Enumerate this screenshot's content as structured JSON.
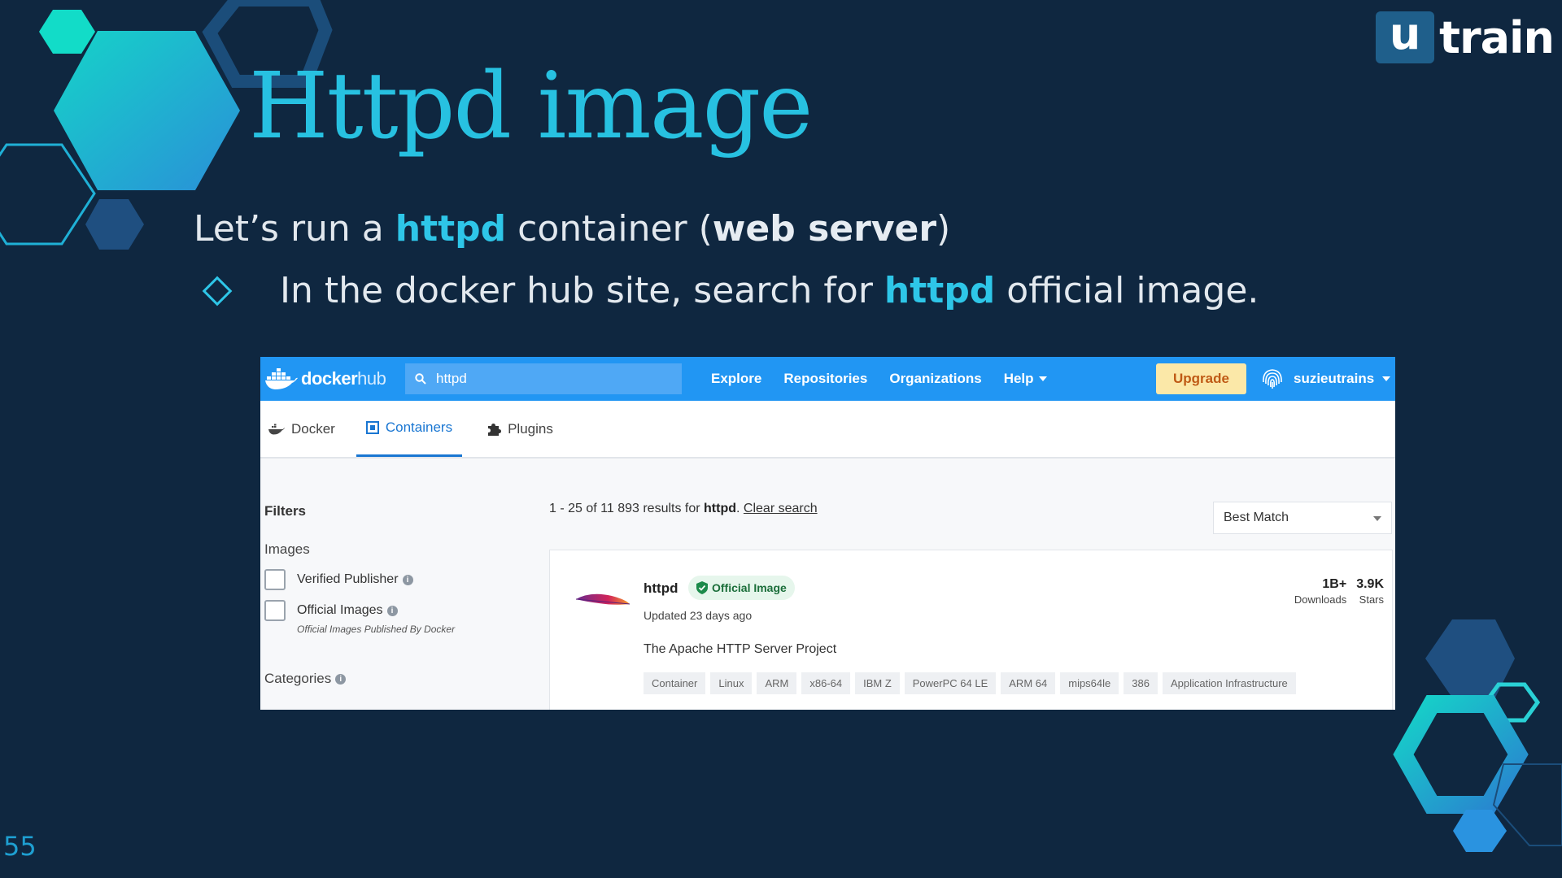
{
  "slide": {
    "title": "Httpd image",
    "lead": {
      "p1": "Let’s run a ",
      "b1": "httpd",
      "p2": " container (",
      "b2": "web server",
      "p3": ")"
    },
    "bullet": {
      "p1": "In the docker hub site, search for ",
      "b1": "httpd",
      "p2": " official image."
    },
    "page_number": "55",
    "logo": {
      "u": "u",
      "word": "train"
    },
    "colors": {
      "background": "#0f2740",
      "accent": "#27c1e1"
    }
  },
  "dockerhub": {
    "logo": {
      "docker": "docker",
      "hub": "hub"
    },
    "search": {
      "value": "httpd",
      "icon": "search-icon"
    },
    "nav": {
      "explore": "Explore",
      "repositories": "Repositories",
      "organizations": "Organizations",
      "help": "Help"
    },
    "upgrade_label": "Upgrade",
    "username": "suzieutrains",
    "tabs": {
      "docker": "Docker",
      "containers": "Containers",
      "plugins": "Plugins"
    },
    "filters": {
      "title": "Filters",
      "images_heading": "Images",
      "verified_publisher": "Verified Publisher",
      "official_images": "Official Images",
      "official_note": "Official Images Published By Docker",
      "categories": "Categories"
    },
    "results": {
      "summary": "1 - 25 of 11 893 results for ",
      "query": "httpd",
      "clear": "Clear search",
      "sort": "Best Match"
    },
    "card": {
      "name": "httpd",
      "badge": "Official Image",
      "updated": "Updated 23 days ago",
      "description": "The Apache HTTP Server Project",
      "downloads_value": "1B+",
      "downloads_label": "Downloads",
      "stars_value": "3.9K",
      "stars_label": "Stars",
      "tags": [
        "Container",
        "Linux",
        "ARM",
        "x86-64",
        "IBM Z",
        "PowerPC 64 LE",
        "ARM 64",
        "mips64le",
        "386",
        "Application Infrastructure"
      ]
    },
    "colors": {
      "topbar": "#2196f3",
      "upgrade_bg": "#fbe8a8",
      "upgrade_text": "#bf5a15",
      "active_tab": "#1976d2"
    }
  }
}
